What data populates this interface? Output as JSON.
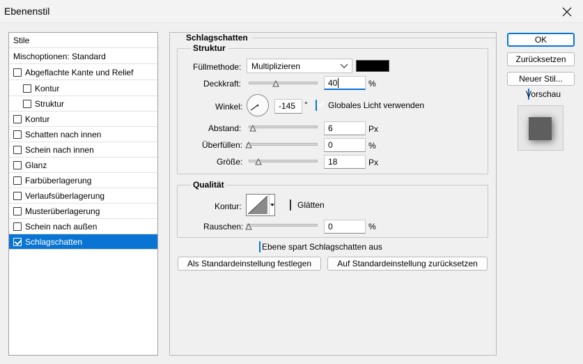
{
  "window": {
    "title": "Ebenenstil",
    "close_icon": "close-icon"
  },
  "styles_list": {
    "header": "Stile",
    "blend_options": "Mischoptionen: Standard",
    "items": [
      {
        "label": "Abgeflachte Kante und Relief",
        "checked": false
      },
      {
        "label": "Kontur",
        "checked": false
      },
      {
        "label": "Struktur",
        "checked": false
      },
      {
        "label": "Kontur",
        "checked": false
      },
      {
        "label": "Schatten nach innen",
        "checked": false
      },
      {
        "label": "Schein nach innen",
        "checked": false
      },
      {
        "label": "Glanz",
        "checked": false
      },
      {
        "label": "Farbüberlagerung",
        "checked": false
      },
      {
        "label": "Verlaufsüberlagerung",
        "checked": false
      },
      {
        "label": "Musterüberlagerung",
        "checked": false
      },
      {
        "label": "Schein nach außen",
        "checked": false
      },
      {
        "label": "Schlagschatten",
        "checked": true
      }
    ]
  },
  "panel": {
    "title": "Schlagschatten",
    "structure": {
      "title": "Struktur",
      "blend_mode_label": "Füllmethode:",
      "blend_mode_value": "Multiplizieren",
      "shadow_color": "#000000",
      "opacity_label": "Deckkraft:",
      "opacity_value": "40",
      "opacity_unit": "%",
      "angle_label": "Winkel:",
      "angle_value": "-145",
      "angle_unit": "°",
      "global_light_label": "Globales Licht verwenden",
      "global_light_checked": true,
      "distance_label": "Abstand:",
      "distance_value": "6",
      "distance_unit": "Px",
      "spread_label": "Überfüllen:",
      "spread_value": "0",
      "spread_unit": "%",
      "size_label": "Größe:",
      "size_value": "18",
      "size_unit": "Px"
    },
    "quality": {
      "title": "Qualität",
      "contour_label": "Kontur:",
      "antialias_label": "Glätten",
      "antialias_checked": false,
      "noise_label": "Rauschen:",
      "noise_value": "0",
      "noise_unit": "%"
    },
    "knockout_label": "Ebene spart Schlagschatten aus",
    "knockout_checked": true,
    "make_default_label": "Als Standardeinstellung festlegen",
    "reset_default_label": "Auf Standardeinstellung zurücksetzen"
  },
  "buttons": {
    "ok": "OK",
    "reset": "Zurücksetzen",
    "new_style": "Neuer Stil...",
    "preview_label": "Vorschau",
    "preview_checked": true
  },
  "colors": {
    "accent": "#0a74d4",
    "selection": "#0a74d4"
  }
}
